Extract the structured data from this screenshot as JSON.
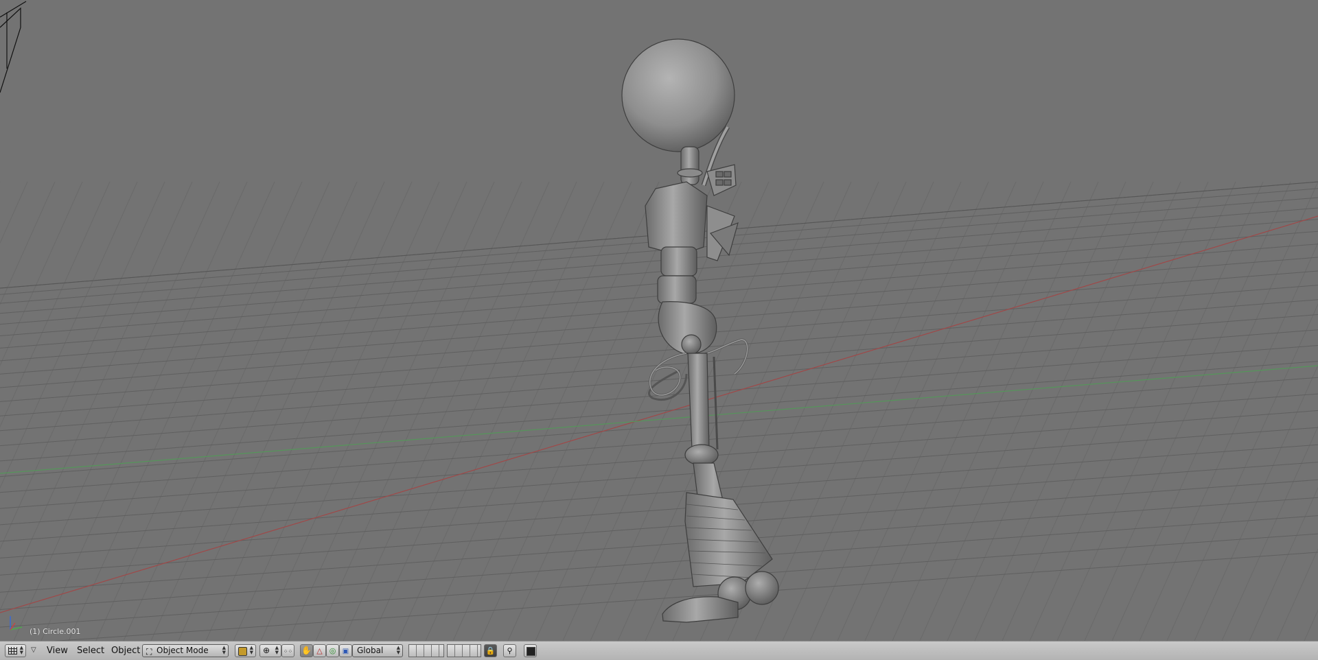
{
  "viewport": {
    "object_label": "(1) Circle.001",
    "background": "#737373",
    "grid_color": "#5f5f5f",
    "x_axis_color": "#a04848",
    "y_axis_color": "#55965a"
  },
  "header": {
    "editor_type_icon": "grid-editor-icon",
    "menus": {
      "view": "View",
      "select": "Select",
      "object": "Object"
    },
    "mode": "Object Mode",
    "orientation": "Global"
  }
}
